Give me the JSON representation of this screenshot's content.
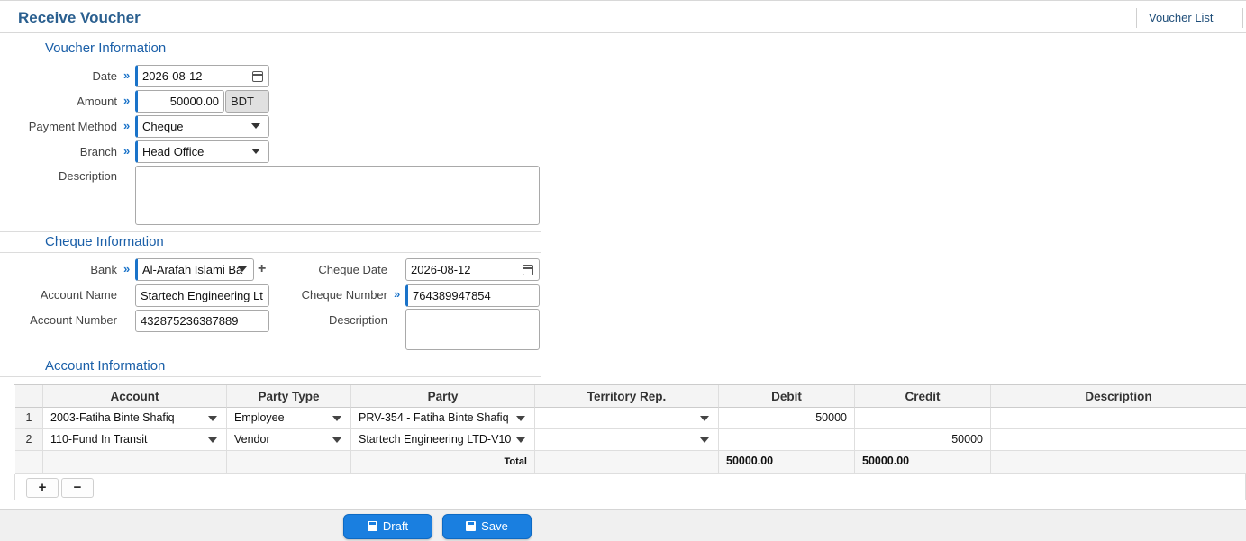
{
  "header": {
    "title": "Receive Voucher",
    "voucher_list_link": "Voucher List"
  },
  "voucher_info": {
    "section_title": "Voucher Information",
    "date_label": "Date",
    "date_value": "2026-08-12",
    "amount_label": "Amount",
    "amount_value": "50000.00",
    "currency": "BDT",
    "payment_method_label": "Payment Method",
    "payment_method_value": "Cheque",
    "branch_label": "Branch",
    "branch_value": "Head Office",
    "description_label": "Description",
    "description_value": ""
  },
  "cheque_info": {
    "section_title": "Cheque Information",
    "bank_label": "Bank",
    "bank_value": "Al-Arafah Islami Ba",
    "account_name_label": "Account Name",
    "account_name_value": "Startech Engineering Lt",
    "account_number_label": "Account Number",
    "account_number_value": "432875236387889",
    "cheque_date_label": "Cheque Date",
    "cheque_date_value": "2026-08-12",
    "cheque_number_label": "Cheque Number",
    "cheque_number_value": "764389947854",
    "description_label": "Description",
    "description_value": ""
  },
  "account_info": {
    "section_title": "Account Information",
    "columns": [
      "Account",
      "Party Type",
      "Party",
      "Territory Rep.",
      "Debit",
      "Credit",
      "Description"
    ],
    "rows": [
      {
        "num": "1",
        "account": "2003-Fatiha Binte Shafiq",
        "party_type": "Employee",
        "party": "PRV-354 - Fatiha Binte Shafiq",
        "territory_rep": "",
        "debit": "50000",
        "credit": "",
        "description": ""
      },
      {
        "num": "2",
        "account": "110-Fund In Transit",
        "party_type": "Vendor",
        "party": "Startech Engineering LTD-V10",
        "territory_rep": "",
        "debit": "",
        "credit": "50000",
        "description": ""
      }
    ],
    "total_label": "Total",
    "total_debit": "50000.00",
    "total_credit": "50000.00",
    "add_row": "+",
    "remove_row": "−"
  },
  "actions": {
    "draft_label": "Draft",
    "save_label": "Save"
  },
  "colors": {
    "accent": "#1a7fe0",
    "title": "#2a5f8f",
    "section": "#1a5fa8"
  }
}
